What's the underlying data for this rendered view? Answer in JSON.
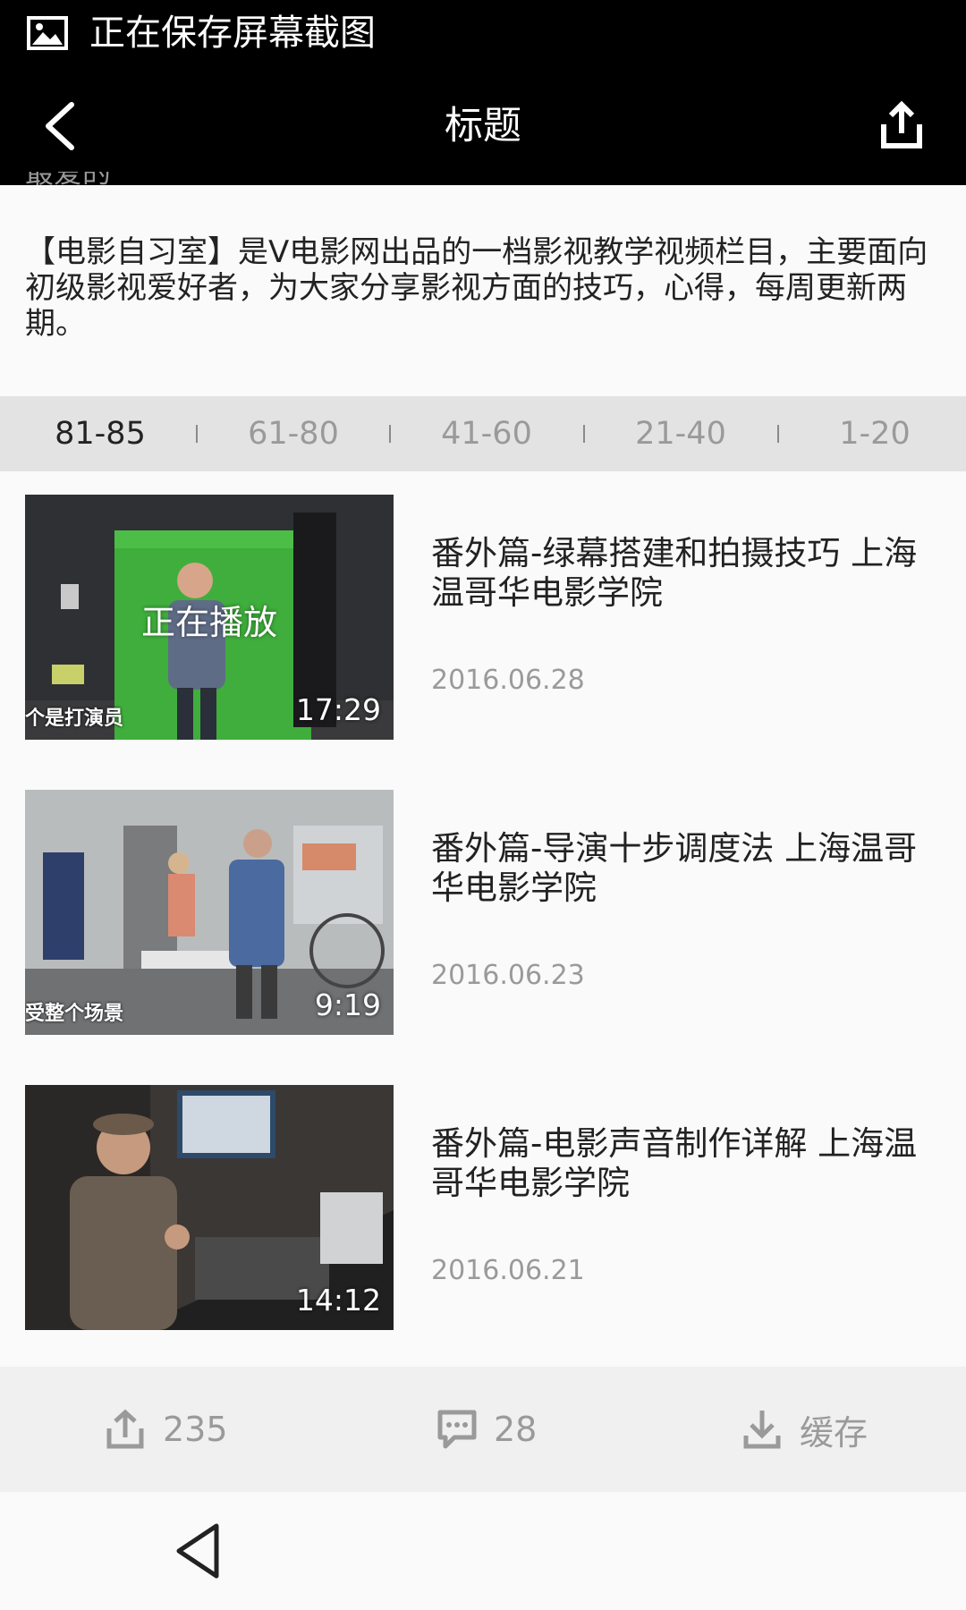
{
  "status_bar": {
    "icon": "image-icon",
    "text": "正在保存屏幕截图"
  },
  "nav": {
    "title": "标题",
    "back_icon": "chevron-left-icon",
    "share_icon": "share-icon"
  },
  "clipped_text": "最爱的",
  "description": "【电影自习室】是V电影网出品的一档影视教学视频栏目，主要面向初级影视爱好者，为大家分享影视方面的技巧，心得，每周更新两期。",
  "tabs": [
    {
      "label": "81-85",
      "active": true
    },
    {
      "label": "61-80",
      "active": false
    },
    {
      "label": "41-60",
      "active": false
    },
    {
      "label": "21-40",
      "active": false
    },
    {
      "label": "1-20",
      "active": false
    }
  ],
  "videos": [
    {
      "title": "番外篇-绿幕搭建和拍摄技巧 上海温哥华电影学院",
      "date": "2016.06.28",
      "duration": "17:29",
      "caption": "个是打演员",
      "playing_label": "正在播放"
    },
    {
      "title": " 番外篇-导演十步调度法 上海温哥华电影学院",
      "date": "2016.06.23",
      "duration": "9:19",
      "caption": "受整个场景"
    },
    {
      "title": " 番外篇-电影声音制作详解 上海温哥华电影学院",
      "date": "2016.06.21",
      "duration": "14:12",
      "caption": ""
    }
  ],
  "actions": {
    "share_count": "235",
    "comment_count": "28",
    "download_label": "缓存"
  },
  "colors": {
    "top_bar": "#000000",
    "tab_bar": "#e3e3e3",
    "action_bar": "#f0f0f0",
    "muted_text": "#9a9a9a"
  }
}
